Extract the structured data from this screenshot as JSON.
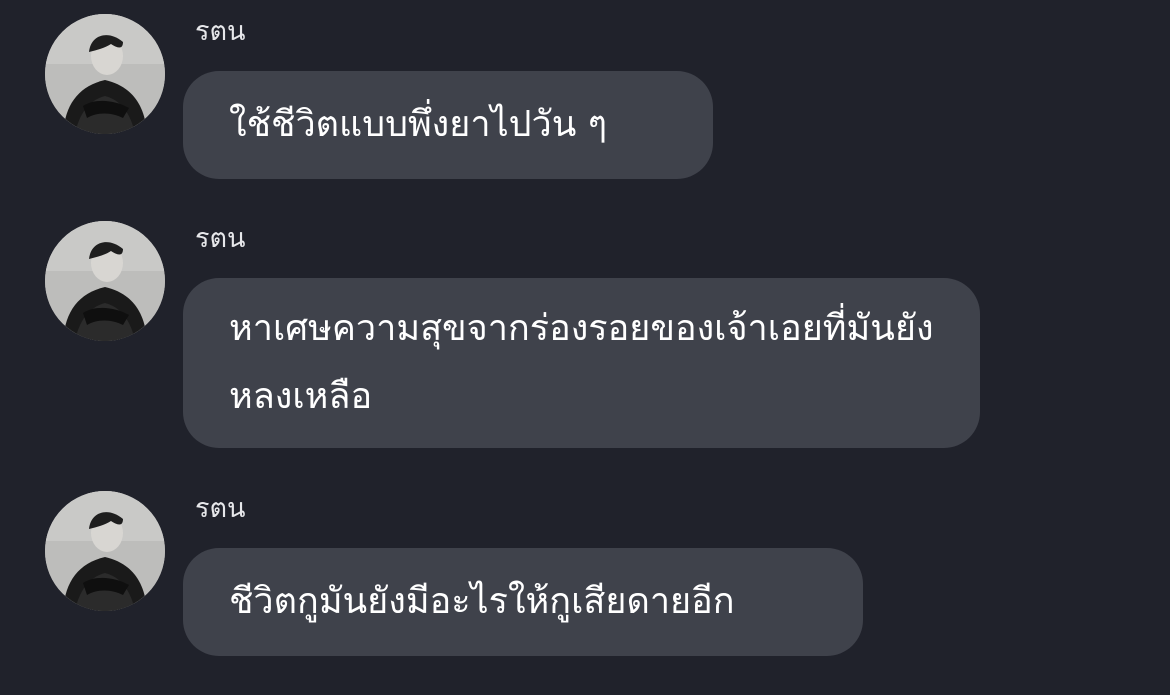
{
  "messages": [
    {
      "sender": "รตน",
      "text": "ใช้ชีวิตแบบพึ่งยาไปวัน ๆ"
    },
    {
      "sender": "รตน",
      "text": "หาเศษความสุขจากร่องรอยของเจ้าเอยที่มันยังหลงเหลือ"
    },
    {
      "sender": "รตน",
      "text": "ชีวิตกูมันยังมีอะไรให้กูเสียดายอีก"
    }
  ],
  "colors": {
    "background": "#20222b",
    "bubble": "#3f424b",
    "text": "#ffffff",
    "sender": "#e6e7ea"
  },
  "icons": {
    "avatar": "profile-photo-avatar"
  }
}
